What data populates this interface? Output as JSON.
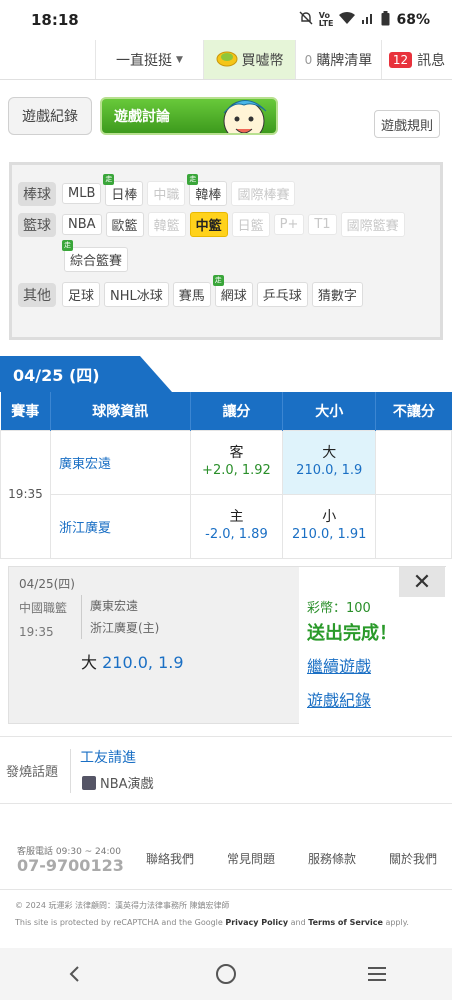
{
  "status": {
    "time": "18:18",
    "battery": "68%"
  },
  "topnav": {
    "follow": "一直挺挺",
    "buy": "買嘘幣",
    "list_count": "0",
    "list": "購牌清單",
    "msg_count": "12",
    "msg": "訊息"
  },
  "toolbar": {
    "record": "遊戲紀錄",
    "discuss": "遊戲討論",
    "rules": "遊戲規則"
  },
  "filter": {
    "baseball": {
      "head": "棒球",
      "items": [
        "MLB",
        "日棒",
        "中職",
        "韓棒",
        "國際棒賽"
      ]
    },
    "basketball": {
      "head": "籃球",
      "items": [
        "NBA",
        "歐籃",
        "韓籃",
        "中籃",
        "日籃",
        "P+",
        "T1",
        "國際籃賽",
        "綜合籃賽"
      ]
    },
    "other": {
      "head": "其他",
      "items": [
        "足球",
        "NHL冰球",
        "賽馬",
        "網球",
        "乒乓球",
        "猜數字"
      ]
    },
    "walk_badge": "走"
  },
  "date_tab": "04/25 (四)",
  "table": {
    "headers": [
      "賽事",
      "球隊資訊",
      "讓分",
      "大小",
      "不讓分"
    ],
    "time": "19:35",
    "rows": [
      {
        "team": "廣東宏遠",
        "spread_side": "客",
        "spread_val": "+2.0, 1.92",
        "ou_side": "大",
        "ou_val": "210.0, 1.9"
      },
      {
        "team": "浙江廣夏",
        "spread_side": "主",
        "spread_val": "-2.0, 1.89",
        "ou_side": "小",
        "ou_val": "210.0, 1.91"
      }
    ]
  },
  "panel": {
    "date": "04/25(四)",
    "league": "中國職籃",
    "time": "19:35",
    "team1": "廣東宏遠",
    "team2": "浙江廣夏(主)",
    "bet_side": "大",
    "bet_val": "210.0, 1.9",
    "coins": "彩幣：100",
    "done": "送出完成！",
    "continue": "繼續遊戲",
    "record": "遊戲紀錄",
    "close": "✕"
  },
  "hot": {
    "label": "發燒話題",
    "title": "工友請進",
    "sub": "NBA演戲"
  },
  "footer": {
    "hours": "客服電話 09:30 ~ 24:00",
    "phone": "07-9700123",
    "links": [
      "聯絡我們",
      "常見問題",
      "服務條款",
      "關於我們"
    ],
    "copyright": "© 2024 玩運彩 法律顧問：漢英得力法律事務所 陳鎮宏律師",
    "recaptcha_a": "This site is protected by reCAPTCHA and the Google ",
    "privacy": "Privacy Policy",
    "and": " and ",
    "terms": "Terms of Service",
    "apply": " apply."
  }
}
